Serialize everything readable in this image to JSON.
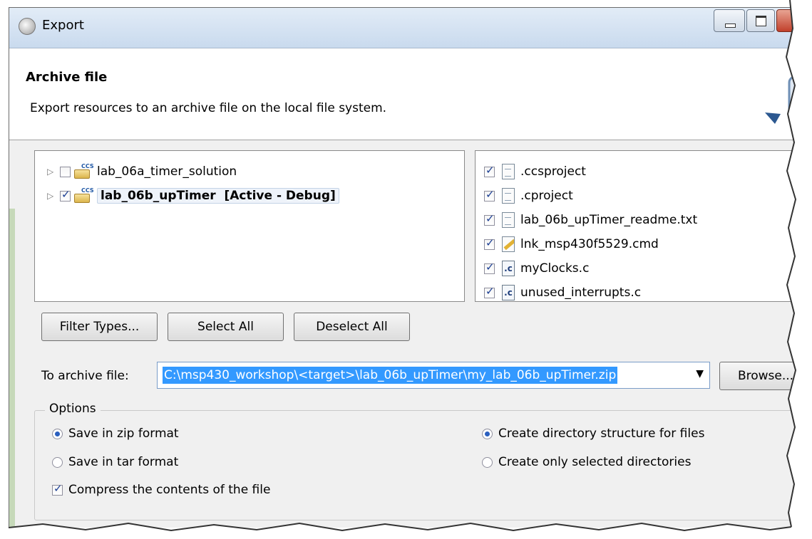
{
  "window": {
    "title": "Export"
  },
  "header": {
    "title": "Archive file",
    "description": "Export resources to an archive file on the local file system."
  },
  "project_tree": [
    {
      "label": "lab_06a_timer_solution",
      "checked": false,
      "bold": false
    },
    {
      "label": "lab_06b_upTimer  [Active - Debug]",
      "checked": true,
      "bold": true
    }
  ],
  "file_list": [
    {
      "label": ".ccsproject",
      "icon": "text-file-icon",
      "checked": true
    },
    {
      "label": ".cproject",
      "icon": "text-file-icon",
      "checked": true
    },
    {
      "label": "lab_06b_upTimer_readme.txt",
      "icon": "text-file-icon",
      "checked": true
    },
    {
      "label": "lnk_msp430f5529.cmd",
      "icon": "linker-cmd-file-icon",
      "checked": true
    },
    {
      "label": "myClocks.c",
      "icon": "c-source-file-icon",
      "checked": true
    },
    {
      "label": "unused_interrupts.c",
      "icon": "c-source-file-icon",
      "checked": true
    }
  ],
  "buttons": {
    "filter_types": "Filter Types...",
    "select_all": "Select All",
    "deselect_all": "Deselect All",
    "browse": "Browse..."
  },
  "archive": {
    "label": "To archive file:",
    "value": "C:\\msp430_workshop\\<target>\\lab_06b_upTimer\\my_lab_06b_upTimer.zip"
  },
  "options": {
    "legend": "Options",
    "save_zip": "Save in zip format",
    "save_tar": "Save in tar format",
    "compress": "Compress the contents of the file",
    "create_dir_structure": "Create directory structure for files",
    "create_selected_dirs": "Create only selected directories",
    "selected_format": "zip",
    "selected_structure": "directory_structure",
    "compress_checked": true
  },
  "colors": {
    "selection": "#3399ff",
    "titlebar": "#c9daee",
    "dialog_bg": "#f0f0f0"
  }
}
